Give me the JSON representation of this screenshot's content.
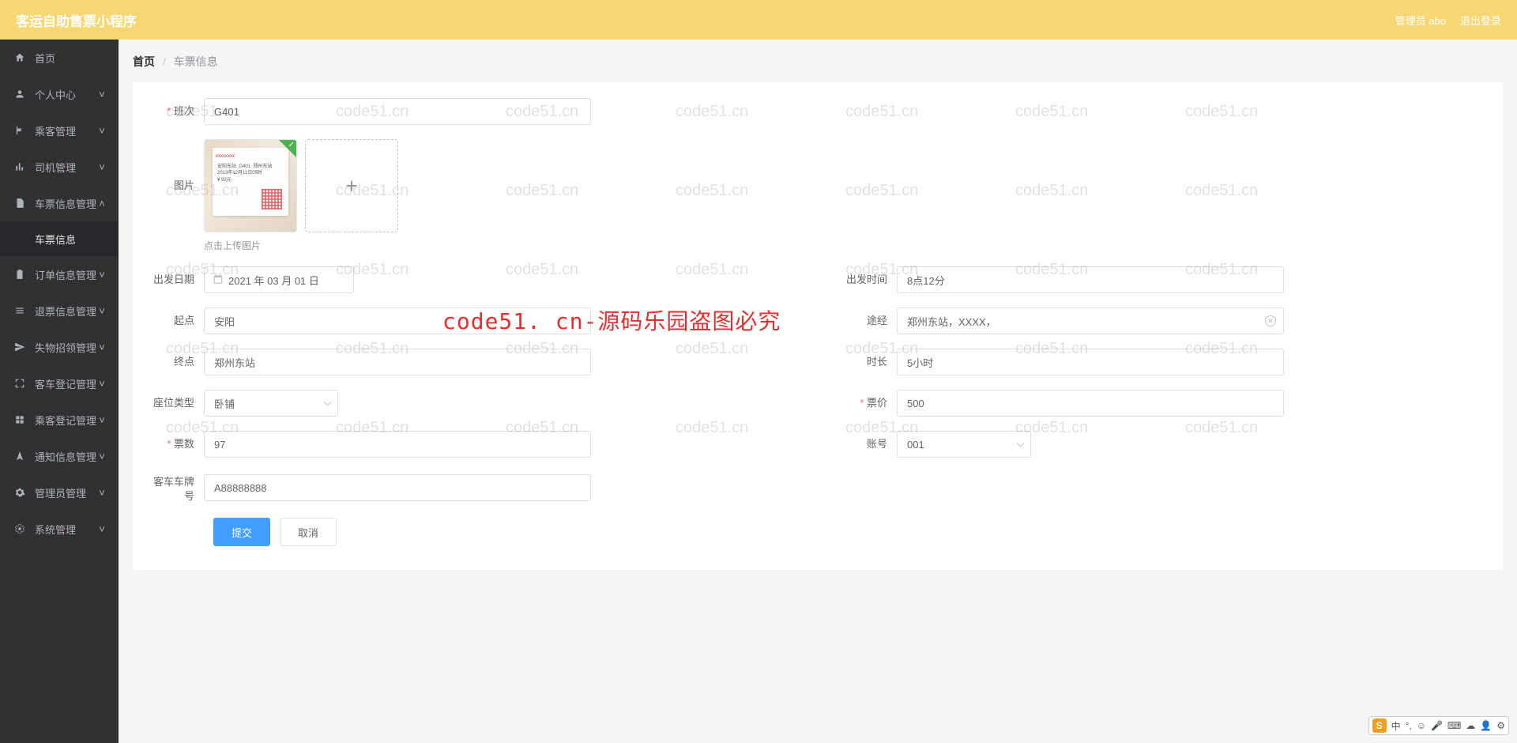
{
  "topbar": {
    "title": "客运自助售票小程序",
    "user_label": "管理员 abo",
    "logout_label": "退出登录"
  },
  "sidebar": [
    {
      "icon": "home",
      "label": "首页",
      "expandable": false
    },
    {
      "icon": "user",
      "label": "个人中心",
      "expandable": true
    },
    {
      "icon": "flag",
      "label": "乘客管理",
      "expandable": true
    },
    {
      "icon": "chart",
      "label": "司机管理",
      "expandable": true
    },
    {
      "icon": "doc",
      "label": "车票信息管理",
      "expandable": true,
      "caret": "up",
      "sub": [
        {
          "label": "车票信息"
        }
      ]
    },
    {
      "icon": "clipboard",
      "label": "订单信息管理",
      "expandable": true
    },
    {
      "icon": "list",
      "label": "退票信息管理",
      "expandable": true
    },
    {
      "icon": "send",
      "label": "失物招领管理",
      "expandable": true
    },
    {
      "icon": "scan",
      "label": "客车登记管理",
      "expandable": true
    },
    {
      "icon": "grid",
      "label": "乘客登记管理",
      "expandable": true
    },
    {
      "icon": "nav",
      "label": "通知信息管理",
      "expandable": true
    },
    {
      "icon": "cog",
      "label": "管理员管理",
      "expandable": true
    },
    {
      "icon": "gear",
      "label": "系统管理",
      "expandable": true
    }
  ],
  "breadcrumb": {
    "root": "首页",
    "leaf": "车票信息"
  },
  "form": {
    "banci_label": "班次",
    "banci_value": "G401",
    "tupian_label": "图片",
    "tupian_help": "点击上传图片",
    "chufaDate_label": "出发日期",
    "chufaDate_value": "2021 年 03 月 01 日",
    "chufaTime_label": "出发时间",
    "chufaTime_value": "8点12分",
    "qidian_label": "起点",
    "qidian_value": "安阳",
    "tujing_label": "途经",
    "tujing_value": "郑州东站，XXXX，",
    "zhongdian_label": "终点",
    "zhongdian_value": "郑州东站",
    "shichang_label": "时长",
    "shichang_value": "5小时",
    "zuowei_label": "座位类型",
    "zuowei_value": "卧铺",
    "piaojia_label": "票价",
    "piaojia_value": "500",
    "piaoshu_label": "票数",
    "piaoshu_value": "97",
    "zhanghao_label": "账号",
    "zhanghao_value": "001",
    "chepai_label": "客车车牌号",
    "chepai_value": "A88888888"
  },
  "buttons": {
    "submit": "提交",
    "cancel": "取消"
  },
  "watermark_text": "code51.cn",
  "watermark_red": "code51. cn-源码乐园盗图必究",
  "ime": {
    "logo": "S",
    "lang": "中",
    "items": [
      "☺",
      "🎤",
      "⌨",
      "☁",
      "👤",
      "⚙"
    ]
  }
}
